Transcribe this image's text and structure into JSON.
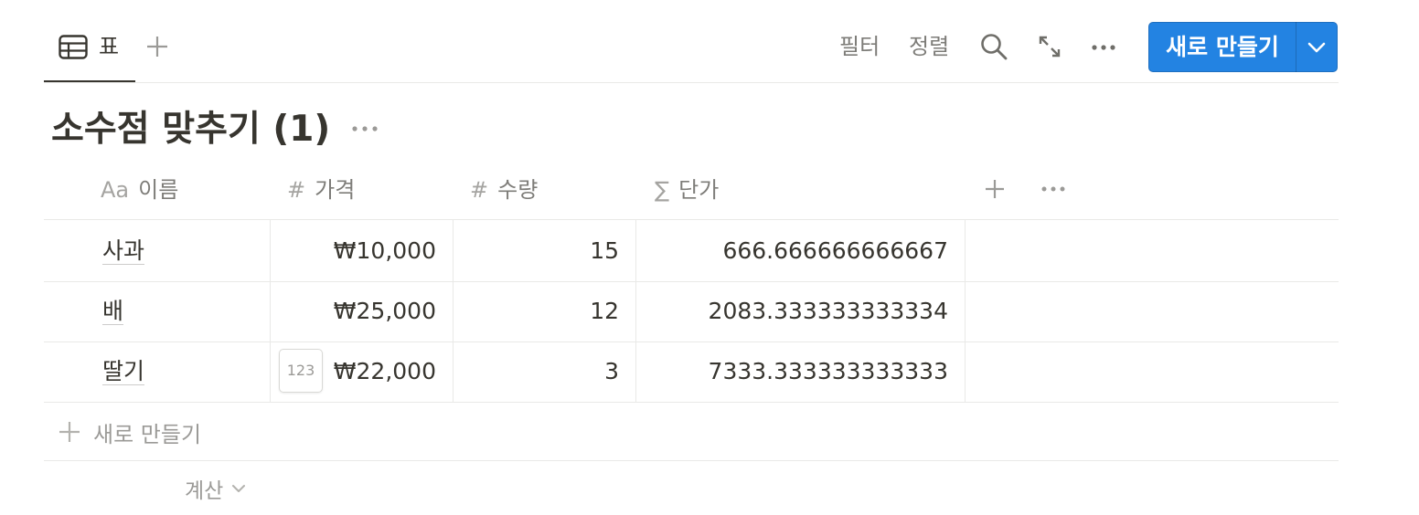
{
  "toolbar": {
    "view_tab_label": "표",
    "filter_label": "필터",
    "sort_label": "정렬",
    "new_button_label": "새로 만들기"
  },
  "page": {
    "title": "소수점 맞추기 (1)"
  },
  "table": {
    "columns": [
      {
        "icon": "text-type-icon",
        "icon_text": "Aa",
        "label": "이름"
      },
      {
        "icon": "number-icon",
        "icon_text": "#",
        "label": "가격"
      },
      {
        "icon": "number-icon",
        "icon_text": "#",
        "label": "수량"
      },
      {
        "icon": "formula-icon",
        "icon_text": "∑",
        "label": "단가"
      }
    ],
    "rows": [
      {
        "name": "사과",
        "price": "₩10,000",
        "qty": "15",
        "unit": "666.666666666667"
      },
      {
        "name": "배",
        "price": "₩25,000",
        "qty": "12",
        "unit": "2083.333333333334"
      },
      {
        "name": "딸기",
        "price": "₩22,000",
        "qty": "3",
        "unit": "7333.333333333333"
      }
    ],
    "number_format_chip": "123",
    "new_row_label": "새로 만들기",
    "calc_label": "계산"
  },
  "colors": {
    "accent": "#2383e2",
    "text": "#37352f",
    "border": "#e9e9e7"
  }
}
